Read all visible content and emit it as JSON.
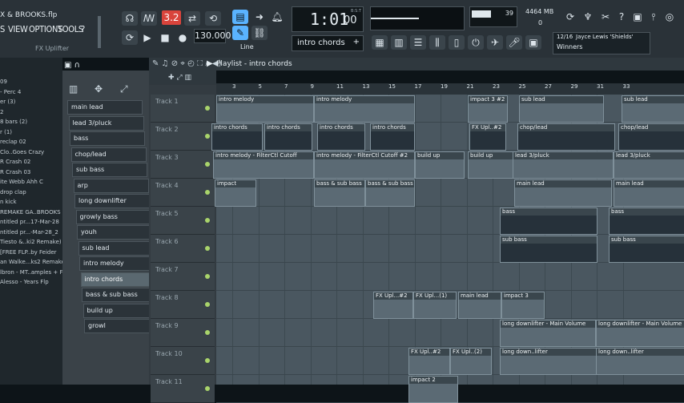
{
  "window": {
    "filename": "X & BROOKS.flp"
  },
  "menu": [
    "S",
    "VIEW",
    "OPTIONS",
    "TOOLS",
    "?"
  ],
  "toolbar": {
    "tempo_value": "130.000",
    "time_display": "1:01",
    "time_sub": "00",
    "time_unit": "B:S:T",
    "pattern_selector": "intro chords",
    "snap_mode": "Line",
    "cpu_value": "39",
    "memory": "4464 MB",
    "memory_sub": "0",
    "hint_counter": "12/16",
    "hint_artist": "Jayce Lewis 'Shields'",
    "hint_title": "Winners",
    "fx_label": "FX Uplifter",
    "step_display": "3.2"
  },
  "playlist": {
    "title": "Playlist - intro chords",
    "ruler": [
      "3",
      "5",
      "7",
      "9",
      "11",
      "13",
      "15",
      "17",
      "19",
      "21",
      "23",
      "25",
      "27",
      "29",
      "31",
      "33"
    ],
    "tracks": [
      "Track 1",
      "Track 2",
      "Track 3",
      "Track 4",
      "Track 5",
      "Track 6",
      "Track 7",
      "Track 8",
      "Track 9",
      "Track 10",
      "Track 11"
    ]
  },
  "patterns": [
    "main lead",
    "lead 3/pluck",
    "bass",
    "chop/lead",
    "sub bass",
    "arp",
    "long downlifter",
    "growly bass",
    "youh",
    "sub lead",
    "intro melody",
    "intro chords",
    "bass & sub bass",
    "build up",
    "growl"
  ],
  "selected_pattern": "intro chords",
  "browser": [
    "09",
    "- Perc 4",
    "er (3)",
    "2",
    "8 bars (2)",
    "r (1)",
    "reclap 02",
    "Clo..Goes Crazy",
    "R Crash 02",
    "R Crash 03",
    "ite Webb Ahh C",
    "drop clap",
    "n kick",
    "REMAKE GA..BROOKS",
    "ntitled pr...17-Mar-28",
    "ntitled pr...-Mar-28_2",
    "Tiesto &..ki2 Remake)",
    "[FREE FLP..by Feider",
    "an Walke...ks2 Remake)",
    "lbron - MT..amples + FLP",
    "Alesso - Years Flp"
  ],
  "clips": {
    "t1": [
      "intro melody",
      "intro melody",
      "impact 3 #2",
      "sub lead",
      "sub lead"
    ],
    "t2": [
      "intro chords",
      "intro chords",
      "intro chords",
      "intro chords",
      "FX Upl..#2",
      "chop/lead",
      "chop/lead"
    ],
    "t3": [
      "intro melody - FilterCtl Cutoff",
      "intro melody - FilterCtl Cutoff #2",
      "build up",
      "build up",
      "lead 3/pluck",
      "lead 3/pluck"
    ],
    "t4": [
      "impact",
      "bass & sub bass",
      "bass & sub bass",
      "main lead",
      "main lead"
    ],
    "t5": [
      "bass",
      "bass"
    ],
    "t6": [
      "sub bass",
      "sub bass"
    ],
    "t8": [
      "FX Upl...#2",
      "FX Upl...(1)",
      "main lead",
      "impact 3"
    ],
    "t9": [
      "long downlifter - Main Volume",
      "long downlifter - Main Volume"
    ],
    "t10": [
      "FX Upl..#2",
      "FX Upl..(2)",
      "long down..lifter",
      "long down..lifter"
    ],
    "t11": [
      "impact 2"
    ]
  }
}
